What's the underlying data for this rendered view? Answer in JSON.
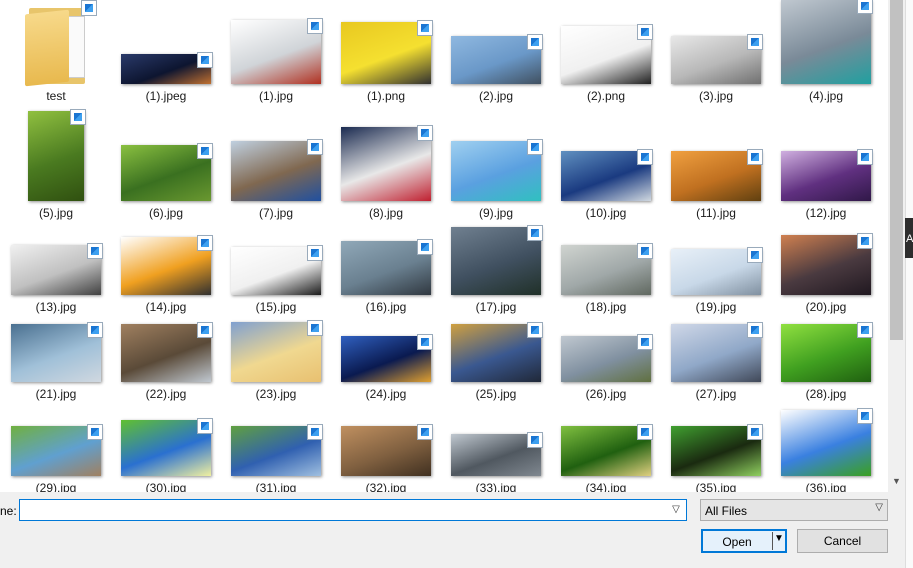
{
  "files": [
    {
      "label": "test",
      "kind": "folder"
    },
    {
      "label": "(1).jpeg",
      "w": 90,
      "h": 30,
      "colors": [
        "#0d1530",
        "#2a3a6a",
        "#c07030"
      ]
    },
    {
      "label": "(1).jpg",
      "w": 90,
      "h": 64,
      "colors": [
        "#d0d4d8",
        "#ffffff",
        "#b03020"
      ]
    },
    {
      "label": "(1).png",
      "w": 90,
      "h": 62,
      "colors": [
        "#f5e030",
        "#e8c820",
        "#303030"
      ]
    },
    {
      "label": "(2).jpg",
      "w": 90,
      "h": 48,
      "colors": [
        "#6a98c8",
        "#8fb8e0",
        "#405060"
      ]
    },
    {
      "label": "(2).png",
      "w": 90,
      "h": 58,
      "colors": [
        "#f0f0f0",
        "#ffffff",
        "#202020"
      ]
    },
    {
      "label": "(3).jpg",
      "w": 90,
      "h": 48,
      "colors": [
        "#b8b8b8",
        "#e8e8e8",
        "#707070"
      ]
    },
    {
      "label": "(4).jpg",
      "w": 90,
      "h": 84,
      "colors": [
        "#7a8a98",
        "#c0c8d0",
        "#20a0a0"
      ]
    },
    {
      "label": "(5).jpg",
      "w": 56,
      "h": 90,
      "colors": [
        "#4a7a20",
        "#90c040",
        "#305010"
      ]
    },
    {
      "label": "(6).jpg",
      "w": 90,
      "h": 56,
      "colors": [
        "#3a7020",
        "#8ac040",
        "#6a9830"
      ]
    },
    {
      "label": "(7).jpg",
      "w": 90,
      "h": 60,
      "colors": [
        "#806850",
        "#c0d0e0",
        "#2050a0"
      ]
    },
    {
      "label": "(8).jpg",
      "w": 90,
      "h": 74,
      "colors": [
        "#e8e8e8",
        "#1a2a50",
        "#c02030"
      ]
    },
    {
      "label": "(9).jpg",
      "w": 90,
      "h": 60,
      "colors": [
        "#5aa0e0",
        "#a0d0f0",
        "#30c0c0"
      ]
    },
    {
      "label": "(10).jpg",
      "w": 90,
      "h": 50,
      "colors": [
        "#1a3a80",
        "#6090c0",
        "#d0d8e0"
      ]
    },
    {
      "label": "(11).jpg",
      "w": 90,
      "h": 50,
      "colors": [
        "#c07020",
        "#f0a040",
        "#604010"
      ]
    },
    {
      "label": "(12).jpg",
      "w": 90,
      "h": 50,
      "colors": [
        "#603080",
        "#d0b0e0",
        "#301848"
      ]
    },
    {
      "label": "(13).jpg",
      "w": 90,
      "h": 50,
      "colors": [
        "#c0c0c0",
        "#f0f0f0",
        "#404040"
      ]
    },
    {
      "label": "(14).jpg",
      "w": 90,
      "h": 58,
      "colors": [
        "#f0a020",
        "#ffffff",
        "#303030"
      ]
    },
    {
      "label": "(15).jpg",
      "w": 90,
      "h": 48,
      "colors": [
        "#f0f0f0",
        "#ffffff",
        "#1a1a1a"
      ]
    },
    {
      "label": "(16).jpg",
      "w": 90,
      "h": 54,
      "colors": [
        "#6a8090",
        "#90a8b8",
        "#303840"
      ]
    },
    {
      "label": "(17).jpg",
      "w": 90,
      "h": 68,
      "colors": [
        "#405060",
        "#708090",
        "#203028"
      ]
    },
    {
      "label": "(18).jpg",
      "w": 90,
      "h": 50,
      "colors": [
        "#a0a8a8",
        "#d0d4d0",
        "#606860"
      ]
    },
    {
      "label": "(19).jpg",
      "w": 90,
      "h": 46,
      "colors": [
        "#c8d8e8",
        "#e8f0f8",
        "#8090a0"
      ]
    },
    {
      "label": "(20).jpg",
      "w": 90,
      "h": 60,
      "colors": [
        "#4a3a40",
        "#d08050",
        "#201820"
      ]
    },
    {
      "label": "(21).jpg",
      "w": 90,
      "h": 58,
      "colors": [
        "#a0c0d8",
        "#4a7090",
        "#d0d8e0"
      ]
    },
    {
      "label": "(22).jpg",
      "w": 90,
      "h": 58,
      "colors": [
        "#5a4a38",
        "#a08060",
        "#c0c8d0"
      ]
    },
    {
      "label": "(23).jpg",
      "w": 90,
      "h": 60,
      "colors": [
        "#f0d890",
        "#80a0d0",
        "#e8c070"
      ]
    },
    {
      "label": "(24).jpg",
      "w": 90,
      "h": 46,
      "colors": [
        "#0a1a50",
        "#3060c0",
        "#e0a030"
      ]
    },
    {
      "label": "(25).jpg",
      "w": 90,
      "h": 58,
      "colors": [
        "#3a5890",
        "#d0a040",
        "#202838"
      ]
    },
    {
      "label": "(26).jpg",
      "w": 90,
      "h": 46,
      "colors": [
        "#8090a0",
        "#c0c8d0",
        "#607040"
      ]
    },
    {
      "label": "(27).jpg",
      "w": 90,
      "h": 58,
      "colors": [
        "#90a8c8",
        "#d0d8e8",
        "#404858"
      ]
    },
    {
      "label": "(28).jpg",
      "w": 90,
      "h": 58,
      "colors": [
        "#40a020",
        "#90e040",
        "#206010"
      ]
    },
    {
      "label": "(29).jpg",
      "w": 90,
      "h": 50,
      "colors": [
        "#60a0d0",
        "#70b040",
        "#a08060"
      ]
    },
    {
      "label": "(30).jpg",
      "w": 90,
      "h": 56,
      "colors": [
        "#2a70d0",
        "#60c030",
        "#f0f0a0"
      ]
    },
    {
      "label": "(31).jpg",
      "w": 90,
      "h": 50,
      "colors": [
        "#3060b0",
        "#60a040",
        "#a0c0e0"
      ]
    },
    {
      "label": "(32).jpg",
      "w": 90,
      "h": 50,
      "colors": [
        "#806040",
        "#c09060",
        "#403020"
      ]
    },
    {
      "label": "(33).jpg",
      "w": 90,
      "h": 42,
      "colors": [
        "#505860",
        "#c0c8d0",
        "#808890"
      ]
    },
    {
      "label": "(34).jpg",
      "w": 90,
      "h": 50,
      "colors": [
        "#206010",
        "#80c040",
        "#e0d080"
      ]
    },
    {
      "label": "(35).jpg",
      "w": 90,
      "h": 50,
      "colors": [
        "#1a2a10",
        "#40a030",
        "#90d060"
      ]
    },
    {
      "label": "(36).jpg",
      "w": 90,
      "h": 66,
      "colors": [
        "#3a80e0",
        "#ffffff",
        "#3aa020"
      ]
    }
  ],
  "bottom": {
    "name_label": "ne:",
    "name_value": "",
    "filter_value": "All Files",
    "open_label": "Open",
    "cancel_label": "Cancel"
  },
  "edge_text": "A"
}
